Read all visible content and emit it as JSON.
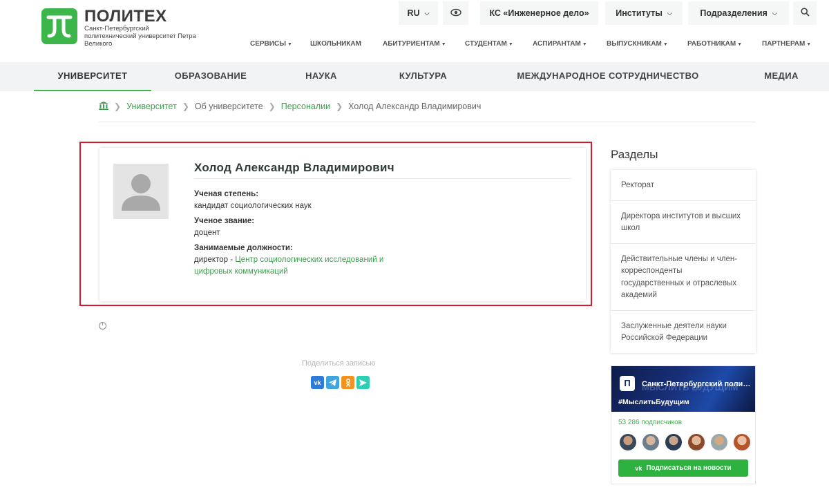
{
  "header": {
    "logo_title": "ПОЛИТЕХ",
    "logo_subtitle": "Санкт-Петербургский политехнический университет Петра Великого",
    "lang": "RU",
    "ks_button": "КС «Инженерное дело»",
    "institutes": "Институты",
    "divisions": "Подразделения",
    "subnav": [
      "СЕРВИСЫ",
      "ШКОЛЬНИКАМ",
      "АБИТУРИЕНТАМ",
      "СТУДЕНТАМ",
      "АСПИРАНТАМ",
      "ВЫПУСКНИКАМ",
      "РАБОТНИКАМ",
      "ПАРТНЕРАМ"
    ]
  },
  "mainnav": {
    "items": [
      "УНИВЕРСИТЕТ",
      "ОБРАЗОВАНИЕ",
      "НАУКА",
      "КУЛЬТУРА",
      "МЕЖДУНАРОДНОЕ СОТРУДНИЧЕСТВО",
      "МЕДИА"
    ],
    "active": "УНИВЕРСИТЕТ"
  },
  "breadcrumb": {
    "items": [
      "Университет",
      "Об университете",
      "Персоналии",
      "Холод Александр Владимирович"
    ]
  },
  "profile": {
    "name": "Холод Александр Владимирович",
    "degree_label": "Ученая степень:",
    "degree": "кандидат социологических наук",
    "title_label": "Ученое звание:",
    "title": "доцент",
    "positions_label": "Занимаемые должности:",
    "position_prefix": "директор - ",
    "position_link_line1": "Центр социологических исследований и",
    "position_link_line2": "цифровых коммуникаций"
  },
  "share": {
    "label": "Поделиться записью",
    "buttons": [
      "vk",
      "telegram",
      "ok",
      "send"
    ]
  },
  "sidebar": {
    "title": "Разделы",
    "items": [
      "Ректорат",
      "Директора институтов и высших школ",
      "Действительные члены и член-корреспонденты государственных и отраслевых академий",
      "Заслуженные деятели науки Российской Федерации"
    ]
  },
  "vk_widget": {
    "group_name": "Санкт-Петербургский поли…",
    "ghost_text": "МЫСЛИТЬ БУДУЩИМ",
    "hashtag": "#МыслитьБудущим",
    "subscribers": "53 286 подписчиков",
    "button": "Подписаться на новости",
    "brand_color": "#2db23f"
  },
  "colors": {
    "accent_green": "#3cb54a",
    "link_green": "#3c9e4e",
    "highlight_red": "#d8192b"
  }
}
